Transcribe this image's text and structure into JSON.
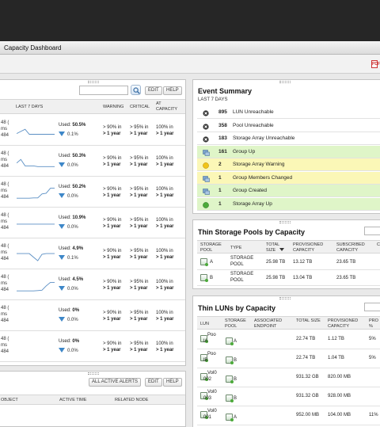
{
  "app": {
    "title": "Capacity Dashboard"
  },
  "toolbar": {
    "export_icon": "pdf-icon",
    "export_label": "PDF"
  },
  "capacity_panel": {
    "buttons": {
      "edit": "EDIT",
      "help": "HELP"
    },
    "search_icon": "search-icon",
    "headers": {
      "last7": "LAST 7 DAYS",
      "warning": "WARNING",
      "critical": "CRITICAL",
      "at_capacity_1": "AT",
      "at_capacity_2": "CAPACITY"
    },
    "rows": [
      {
        "m1": "48 (",
        "m2": "ms",
        "m3": "484",
        "used_label": "Used:",
        "used": "50.5%",
        "delta": "0.1%",
        "trend": [
          0.7,
          0.55,
          0.4,
          0.75,
          0.75,
          0.75,
          0.75,
          0.75,
          0.75,
          0.75
        ],
        "warn1": "> 90% in",
        "warn2": "> 1 year",
        "crit1": "> 95% in",
        "crit2": "> 1 year",
        "cap1": "100% in",
        "cap2": "> 1 year"
      },
      {
        "m1": "48 (",
        "m2": "ms",
        "m3": "484",
        "used_label": "Used:",
        "used": "50.3%",
        "delta": "0.0%",
        "trend": [
          0.6,
          0.35,
          0.8,
          0.8,
          0.8,
          0.85,
          0.85,
          0.85,
          0.85,
          0.85
        ],
        "warn1": "> 90% in",
        "warn2": "> 1 year",
        "crit1": "> 95% in",
        "crit2": "> 1 year",
        "cap1": "100% in",
        "cap2": "> 1 year"
      },
      {
        "m1": "48 (",
        "m2": "ms",
        "m3": "484",
        "used_label": "Used:",
        "used": "50.2%",
        "delta": "0.0%",
        "trend": [
          0.9,
          0.9,
          0.9,
          0.9,
          0.88,
          0.88,
          0.6,
          0.55,
          0.2,
          0.2
        ],
        "warn1": "> 90% in",
        "warn2": "> 1 year",
        "crit1": "> 95% in",
        "crit2": "> 1 year",
        "cap1": "100% in",
        "cap2": "> 1 year"
      },
      {
        "m1": "48 (",
        "m2": "ms",
        "m3": "484",
        "used_label": "Used:",
        "used": "10.9%",
        "delta": "0.0%",
        "trend": [
          0.55,
          0.55,
          0.55,
          0.55,
          0.55,
          0.55,
          0.55,
          0.55,
          0.55,
          0.55
        ],
        "warn1": "> 90% in",
        "warn2": "> 1 year",
        "crit1": "> 95% in",
        "crit2": "> 1 year",
        "cap1": "100% in",
        "cap2": "> 1 year"
      },
      {
        "m1": "48 (",
        "m2": "ms",
        "m3": "484",
        "used_label": "Used:",
        "used": "4.9%",
        "delta": "0.1%",
        "trend": [
          0.45,
          0.45,
          0.45,
          0.45,
          0.7,
          0.95,
          0.5,
          0.45,
          0.45,
          0.45
        ],
        "warn1": "> 90% in",
        "warn2": "> 1 year",
        "crit1": "> 95% in",
        "crit2": "> 1 year",
        "cap1": "100% in",
        "cap2": "> 1 year"
      },
      {
        "m1": "48 (",
        "m2": "ms",
        "m3": "484",
        "used_label": "Used:",
        "used": "4.5%",
        "delta": "0.0%",
        "trend": [
          0.9,
          0.9,
          0.9,
          0.9,
          0.9,
          0.88,
          0.85,
          0.55,
          0.3,
          0.3
        ],
        "warn1": "> 90% in",
        "warn2": "> 1 year",
        "crit1": "> 95% in",
        "crit2": "> 1 year",
        "cap1": "100% in",
        "cap2": "> 1 year"
      },
      {
        "m1": "48 (",
        "m2": "ms",
        "m3": "484",
        "used_label": "Used:",
        "used": "0%",
        "delta": "0.0%",
        "trend": null,
        "warn1": "> 90% in",
        "warn2": "> 1 year",
        "crit1": "> 95% in",
        "crit2": "> 1 year",
        "cap1": "100% in",
        "cap2": "> 1 year"
      },
      {
        "m1": "48 (",
        "m2": "ms",
        "m3": "484",
        "used_label": "Used:",
        "used": "0%",
        "delta": "0.0%",
        "trend": null,
        "warn1": "> 90% in",
        "warn2": "> 1 year",
        "crit1": "> 95% in",
        "crit2": "> 1 year",
        "cap1": "100% in",
        "cap2": "> 1 year"
      }
    ]
  },
  "alerts_panel": {
    "buttons": {
      "all_active": "ALL ACTIVE ALERTS",
      "edit": "EDIT",
      "help": "HELP"
    },
    "headers": {
      "object": "OBJECT",
      "active_time": "ACTIVE TIME",
      "related_node": "RELATED NODE"
    }
  },
  "event_summary": {
    "title": "Event Summary",
    "subtitle": "LAST 7 DAYS",
    "items": [
      {
        "icon": "critical-icon",
        "count": "895",
        "text": "LUN Unreachable",
        "bg": "#ffffff"
      },
      {
        "icon": "critical-icon",
        "count": "358",
        "text": "Pool Unreachable",
        "bg": "#ffffff"
      },
      {
        "icon": "critical-icon",
        "count": "183",
        "text": "Storage Array Unreachable",
        "bg": "#ffffff"
      },
      {
        "icon": "group-icon",
        "count": "161",
        "text": "Group Up",
        "bg": "#dff5c8"
      },
      {
        "icon": "warning-icon",
        "count": "2",
        "text": "Storage Array Warning",
        "bg": "#fbf7b7"
      },
      {
        "icon": "group-icon",
        "count": "1",
        "text": "Group Members Changed",
        "bg": "#fbf7b7"
      },
      {
        "icon": "group-icon",
        "count": "1",
        "text": "Group Created",
        "bg": "#dff5c8"
      },
      {
        "icon": "up-icon",
        "count": "1",
        "text": "Storage Array Up",
        "bg": "#dff5c8"
      }
    ]
  },
  "pools": {
    "title": "Thin Storage Pools by Capacity",
    "headers": {
      "pool1": "STORAGE",
      "pool2": "POOL",
      "type": "TYPE",
      "total1": "TOTAL",
      "total2": "SIZE",
      "prov1": "PROVISIONED",
      "prov2": "CAPACITY",
      "sub1": "SUBSCRIBED",
      "sub2": "CAPACITY",
      "extra": "C"
    },
    "rows": [
      {
        "name": "A",
        "type1": "STORAGE",
        "type2": "POOL",
        "total": "25.98 TB",
        "prov": "13.12 TB",
        "sub": "23.65 TB"
      },
      {
        "name": "B",
        "type1": "STORAGE",
        "type2": "POOL",
        "total": "25.98 TB",
        "prov": "13.04 TB",
        "sub": "23.65 TB"
      }
    ]
  },
  "luns": {
    "title": "Thin LUNs by Capacity",
    "headers": {
      "lun": "LUN",
      "pool1": "STORAGE",
      "pool2": "POOL",
      "ep1": "ASSOCIATED",
      "ep2": "ENDPOINT",
      "total": "TOTAL SIZE",
      "prov1": "PROVISIONED",
      "prov2": "CAPACITY",
      "pr1": "PRO",
      "pr2": "%"
    },
    "rows": [
      {
        "lun1": "Poo",
        "lun2": "lA",
        "pool": "A",
        "total": "22.74 TB",
        "prov": "1.12 TB",
        "pct": "5%"
      },
      {
        "lun1": "Poo",
        "lun2": "lB",
        "pool": "B",
        "total": "22.74 TB",
        "prov": "1.04 TB",
        "pct": "5%"
      },
      {
        "lun1": "Vol0",
        "lun2": "002",
        "pool": "B",
        "total": "931.32 GB",
        "prov": "820.00 MB",
        "pct": ""
      },
      {
        "lun1": "Vol0",
        "lun2": "003",
        "pool": "B",
        "total": "931.32 GB",
        "prov": "928.00 MB",
        "pct": ""
      },
      {
        "lun1": "Vol0",
        "lun2": "001",
        "pool": "A",
        "total": "952.00 MB",
        "prov": "104.00 MB",
        "pct": "11%"
      }
    ]
  }
}
